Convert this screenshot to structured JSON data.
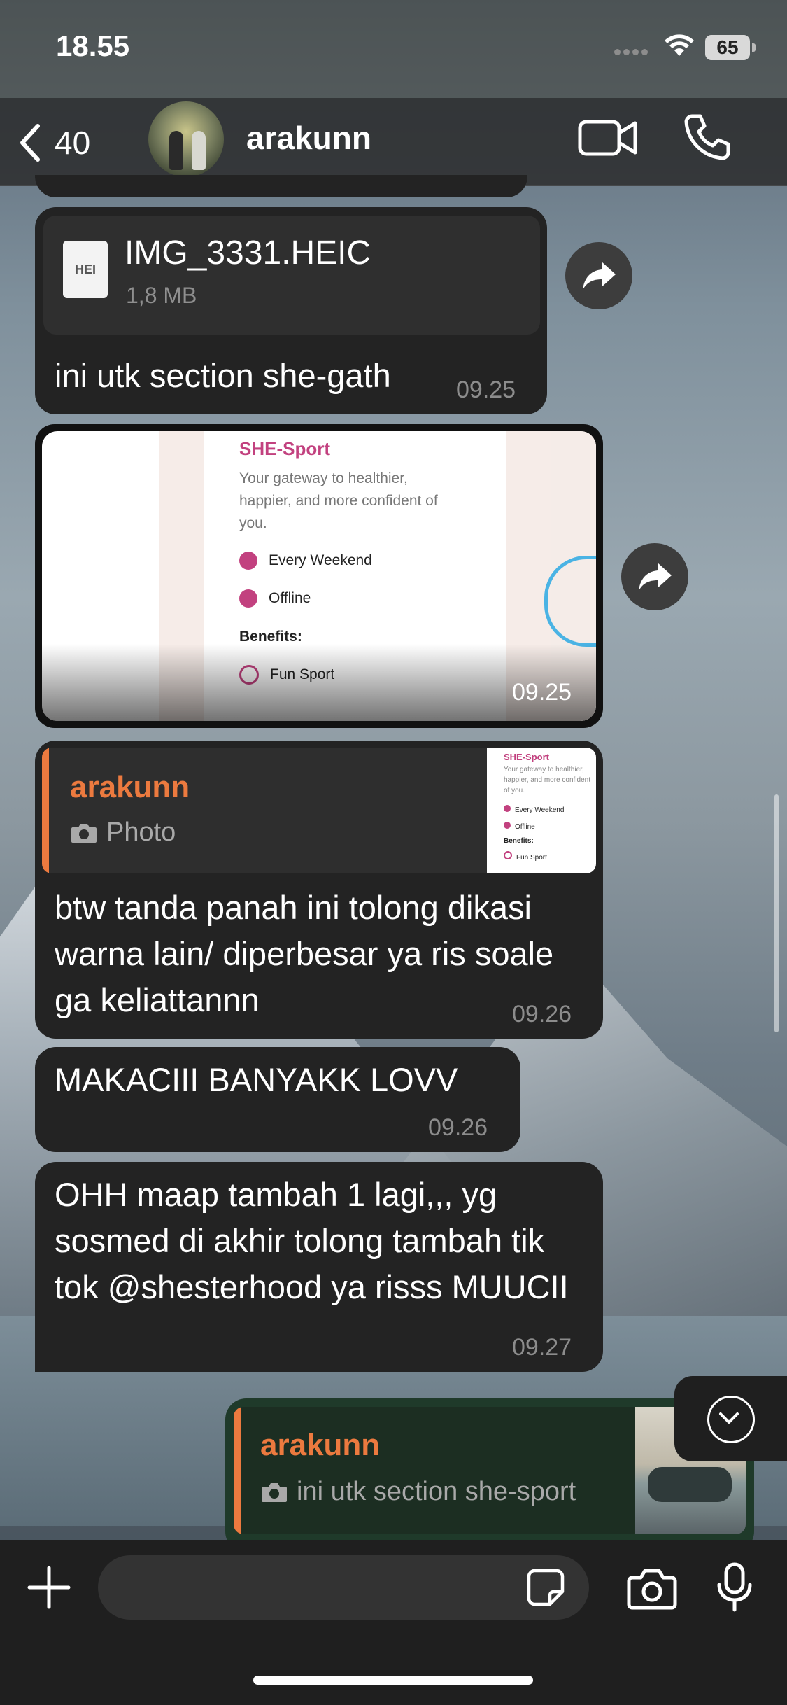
{
  "status_bar": {
    "time": "18.55",
    "battery": "65"
  },
  "header": {
    "back_count": "40",
    "contact_name": "arakunn"
  },
  "messages": [
    {
      "type": "file",
      "file_name": "IMG_3331.HEIC",
      "file_badge": "HEI",
      "file_size": "1,8 MB",
      "caption": "ini utk section she-gath",
      "time": "09.25"
    },
    {
      "type": "image",
      "time": "09.25",
      "image_content": {
        "title": "SHE-Sport",
        "description": "Your gateway to healthier, happier, and more confident of you.",
        "schedule": "Every Weekend",
        "location": "Offline",
        "benefits_label": "Benefits:",
        "benefit_1": "Fun Sport"
      }
    },
    {
      "type": "reply",
      "reply_to_name": "arakunn",
      "reply_to_type": "Photo",
      "text": "btw tanda panah ini tolong dikasi warna lain/ diperbesar ya ris soale ga keliattannn",
      "time": "09.26"
    },
    {
      "type": "text",
      "text": "MAKACIII BANYAKK LOVV",
      "time": "09.26"
    },
    {
      "type": "text",
      "text": "OHH maap tambah 1 lagi,,, yg sosmed di akhir tolong tambah tik tok @shesterhood ya risss MUUCII",
      "time": "09.27"
    },
    {
      "type": "outgoing_reply",
      "reply_to_name": "arakunn",
      "reply_to_text": "ini utk section she-sport"
    }
  ],
  "icons": {
    "back": "chevron-left-icon",
    "video": "video-camera-icon",
    "call": "phone-icon",
    "forward": "forward-arrow-icon",
    "camera": "camera-icon",
    "attach": "plus-icon",
    "sticker": "sticker-icon",
    "mic": "microphone-icon",
    "scroll_down": "chevron-down-icon"
  },
  "colors": {
    "reply_accent": "#ec7a3f",
    "brand_pink": "#c2417f",
    "bubble_incoming": "#232323",
    "bubble_outgoing": "#1f3a2a"
  }
}
